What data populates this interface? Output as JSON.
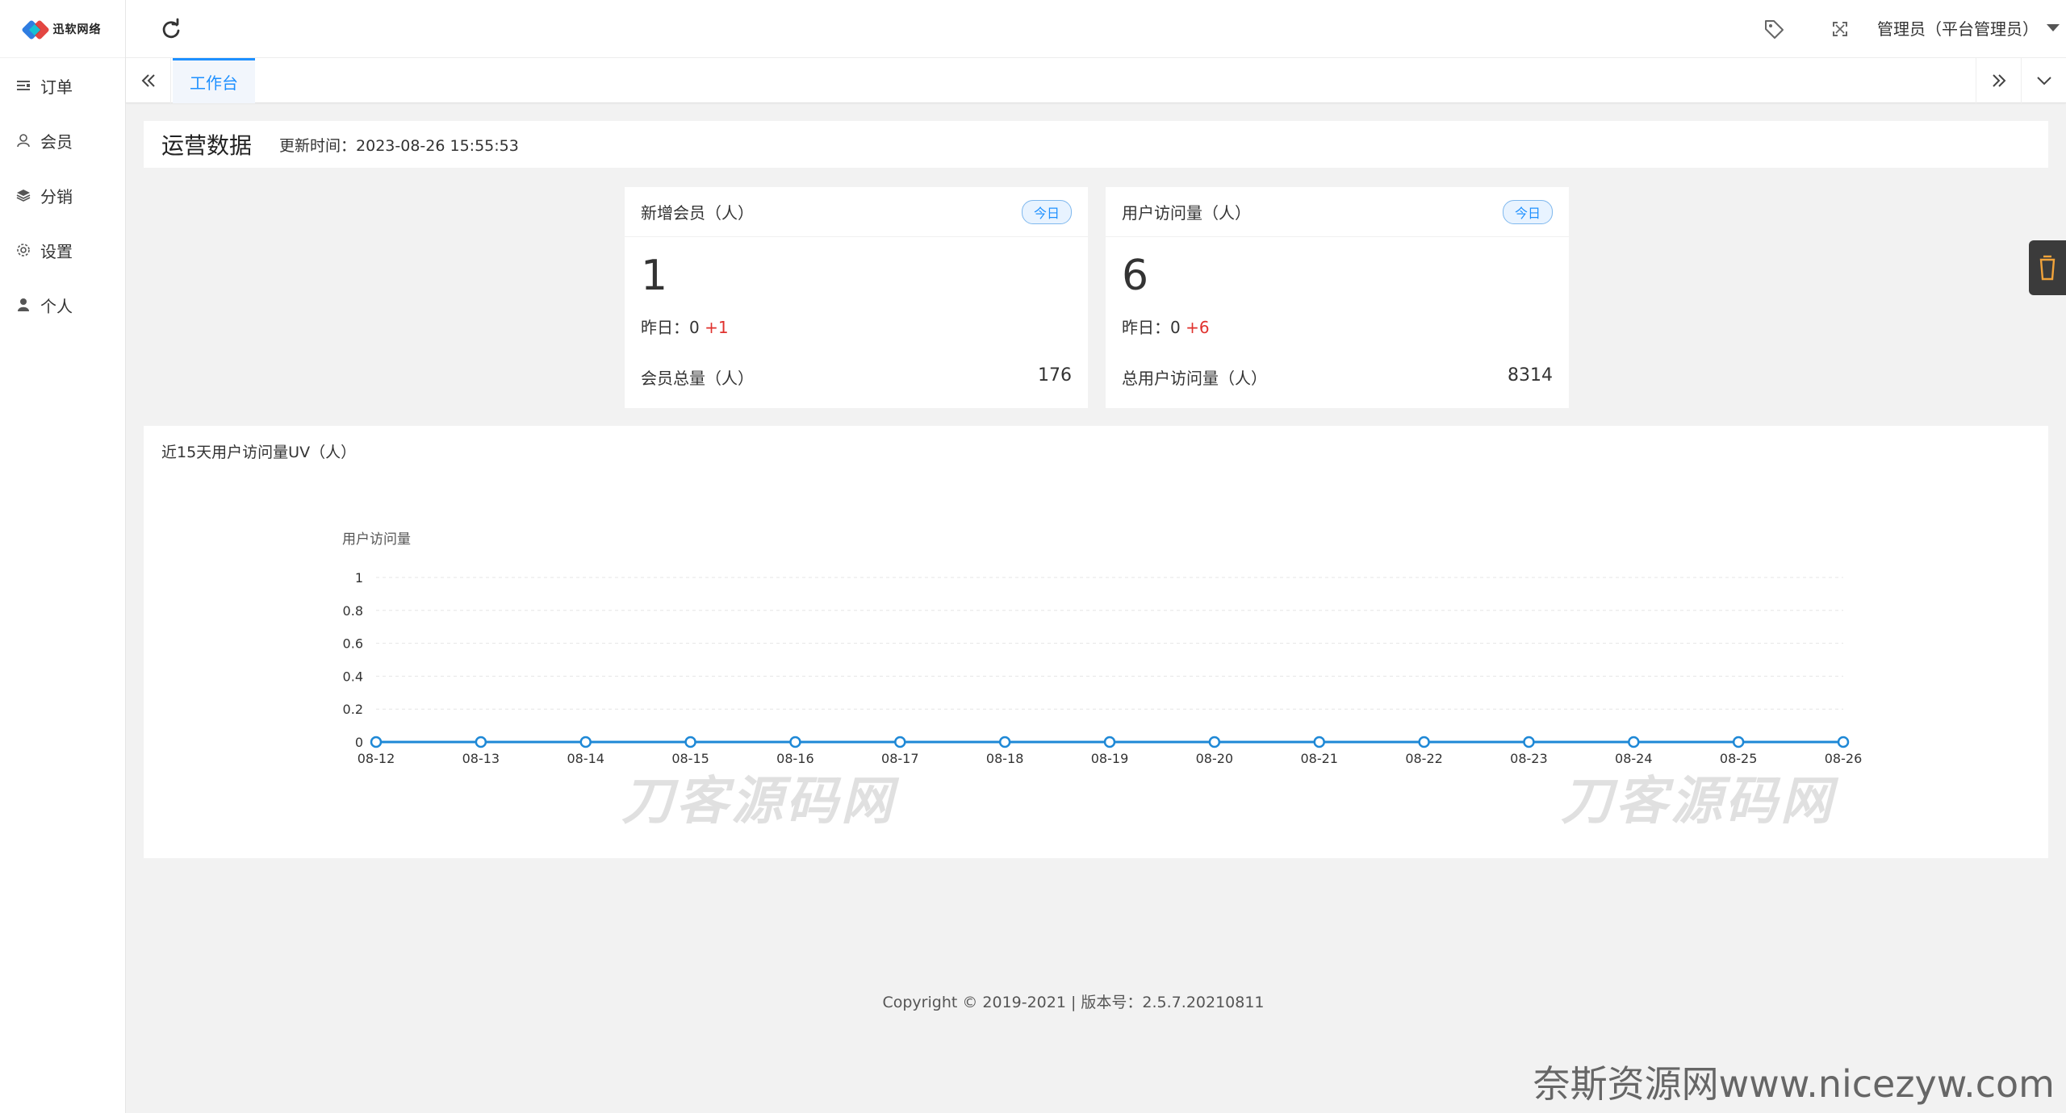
{
  "brand": {
    "logo_text": "迅软网络"
  },
  "sidebar": {
    "items": [
      {
        "label": "订单",
        "icon": "list-icon"
      },
      {
        "label": "会员",
        "icon": "user-outline-icon"
      },
      {
        "label": "分销",
        "icon": "layers-icon"
      },
      {
        "label": "设置",
        "icon": "gear-icon"
      },
      {
        "label": "个人",
        "icon": "person-icon"
      }
    ]
  },
  "header": {
    "user": "管理员（平台管理员）"
  },
  "tabs": {
    "active": "工作台"
  },
  "ops": {
    "title": "运营数据",
    "update_label": "更新时间：",
    "update_time": "2023-08-26 15:55:53"
  },
  "cards": [
    {
      "title": "新增会员（人）",
      "badge": "今日",
      "value": "1",
      "yesterday_label": "昨日：",
      "yesterday_value": "0",
      "diff": "+1",
      "total_label": "会员总量（人）",
      "total_value": "176"
    },
    {
      "title": "用户访问量（人）",
      "badge": "今日",
      "value": "6",
      "yesterday_label": "昨日：",
      "yesterday_value": "0",
      "diff": "+6",
      "total_label": "总用户访问量（人）",
      "total_value": "8314"
    }
  ],
  "chart_panel": {
    "title": "近15天用户访问量UV（人）"
  },
  "chart_data": {
    "type": "line",
    "title": "",
    "ylabel": "用户访问量",
    "x": [
      "08-12",
      "08-13",
      "08-14",
      "08-15",
      "08-16",
      "08-17",
      "08-18",
      "08-19",
      "08-20",
      "08-21",
      "08-22",
      "08-23",
      "08-24",
      "08-25",
      "08-26"
    ],
    "series": [
      {
        "values": [
          0,
          0,
          0,
          0,
          0,
          0,
          0,
          0,
          0,
          0,
          0,
          0,
          0,
          0,
          0
        ]
      }
    ],
    "ylim": [
      0,
      1
    ],
    "yticks": [
      "0",
      "0.2",
      "0.4",
      "0.6",
      "0.8",
      "1"
    ],
    "grid": true,
    "color": "#1e88d6"
  },
  "watermarks": [
    "刀客源码网",
    "刀客源码网"
  ],
  "footer": {
    "text": "Copyright © 2019-2021   |  版本号：2.5.7.20210811"
  },
  "corner_mark": "奈斯资源网www.nicezyw.com"
}
